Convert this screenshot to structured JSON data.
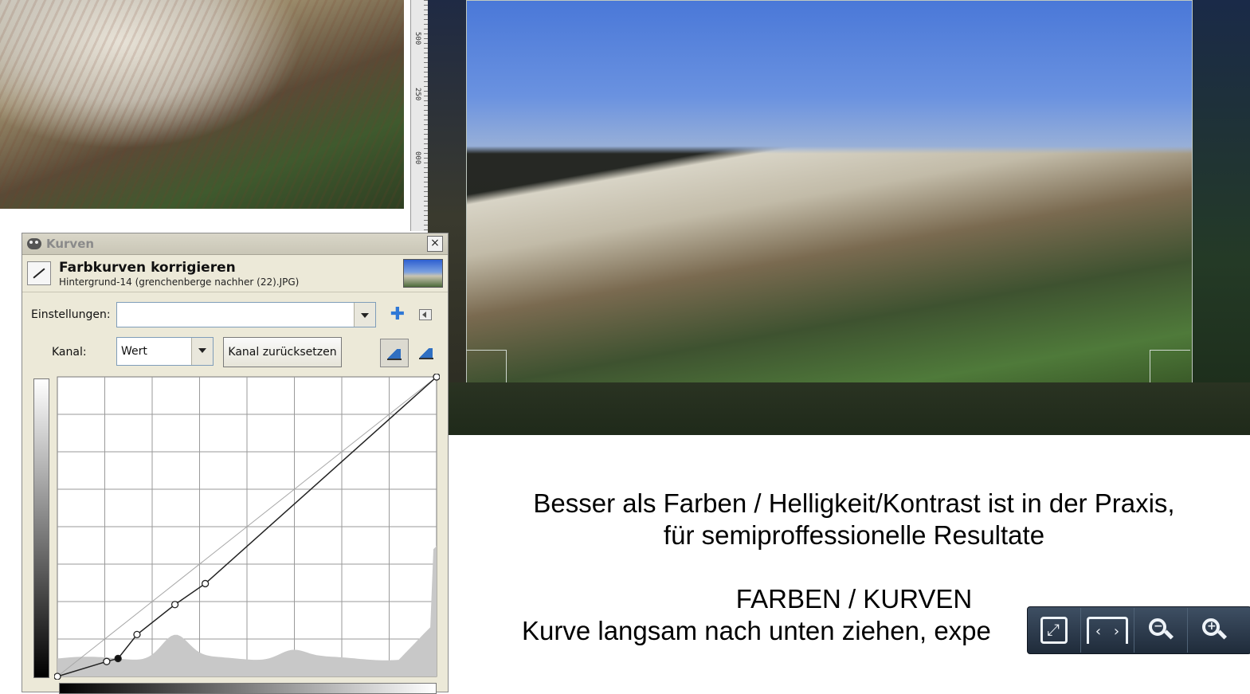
{
  "ruler": {
    "marks": [
      "500",
      "250",
      "000"
    ]
  },
  "dialog": {
    "title": "Kurven",
    "close": "×",
    "header_title": "Farbkurven korrigieren",
    "header_subtitle": "Hintergrund-14 (grenchenberge nachher (22).JPG)",
    "settings_label": "Einstellungen:",
    "settings_value": "",
    "channel_label": "Kanal:",
    "channel_value": "Wert",
    "reset_channel_label": "Kanal zurücksetzen",
    "icons": {
      "add_preset": "plus-icon",
      "manage_presets": "pin-icon",
      "linear_histogram": "histogram-linear-icon",
      "log_histogram": "histogram-log-icon"
    },
    "curve": {
      "points": [
        [
          0,
          0
        ],
        [
          0.13,
          0.05
        ],
        [
          0.16,
          0.06
        ],
        [
          0.21,
          0.14
        ],
        [
          0.31,
          0.24
        ],
        [
          0.39,
          0.31
        ],
        [
          1.0,
          1.0
        ]
      ]
    }
  },
  "slide": {
    "line1": "Besser als Farben / Helligkeit/Kontrast ist in der Praxis,",
    "line2": "für semiproffessionelle Resultate",
    "line3": "FARBEN / KURVEN",
    "line4": "Kurve langsam nach unten ziehen, expe"
  },
  "viewer_toolbar": {
    "icons": [
      "fit-to-window-icon",
      "page-width-icon",
      "zoom-out-icon",
      "zoom-in-icon"
    ],
    "zoom_out_sign": "−",
    "zoom_in_sign": "+",
    "page_left": "‹",
    "page_right": "›"
  },
  "colors": {
    "dialog_bg": "#ece9d8",
    "toolbar_bg": "#2c3a4c",
    "accent_blue": "#2f78d6"
  }
}
